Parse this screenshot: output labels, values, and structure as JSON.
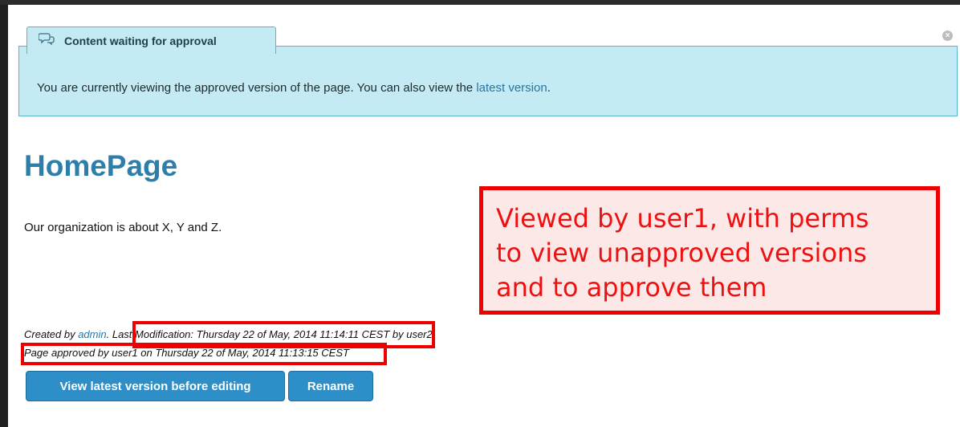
{
  "alert": {
    "title": "Content waiting for approval",
    "message_prefix": "You are currently viewing the approved version of the page. You can also view the ",
    "link_text": "latest version",
    "message_suffix": "."
  },
  "page": {
    "title": "HomePage",
    "body": "Our organization is about X, Y and Z."
  },
  "annotation": {
    "lines": [
      "Viewed by user1, with perms",
      "to view unapproved versions",
      "and to approve them"
    ]
  },
  "meta": {
    "created_prefix": "Created by ",
    "created_user": "admin",
    "modification": ". Last Modification: Thursday 22 of May, 2014 11:14:11 CEST by user2.",
    "approved": "Page approved by user1 on Thursday 22 of May, 2014 11:13:15 CEST"
  },
  "buttons": {
    "view_latest": "View latest version before editing",
    "rename": "Rename"
  }
}
